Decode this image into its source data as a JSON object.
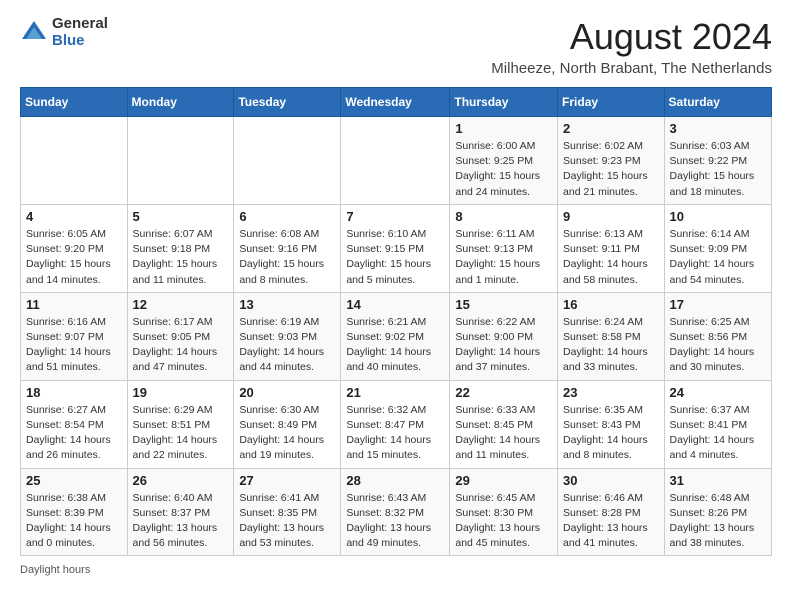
{
  "logo": {
    "general": "General",
    "blue": "Blue"
  },
  "title": "August 2024",
  "subtitle": "Milheeze, North Brabant, The Netherlands",
  "weekdays": [
    "Sunday",
    "Monday",
    "Tuesday",
    "Wednesday",
    "Thursday",
    "Friday",
    "Saturday"
  ],
  "weeks": [
    [
      {
        "day": "",
        "info": ""
      },
      {
        "day": "",
        "info": ""
      },
      {
        "day": "",
        "info": ""
      },
      {
        "day": "",
        "info": ""
      },
      {
        "day": "1",
        "info": "Sunrise: 6:00 AM\nSunset: 9:25 PM\nDaylight: 15 hours\nand 24 minutes."
      },
      {
        "day": "2",
        "info": "Sunrise: 6:02 AM\nSunset: 9:23 PM\nDaylight: 15 hours\nand 21 minutes."
      },
      {
        "day": "3",
        "info": "Sunrise: 6:03 AM\nSunset: 9:22 PM\nDaylight: 15 hours\nand 18 minutes."
      }
    ],
    [
      {
        "day": "4",
        "info": "Sunrise: 6:05 AM\nSunset: 9:20 PM\nDaylight: 15 hours\nand 14 minutes."
      },
      {
        "day": "5",
        "info": "Sunrise: 6:07 AM\nSunset: 9:18 PM\nDaylight: 15 hours\nand 11 minutes."
      },
      {
        "day": "6",
        "info": "Sunrise: 6:08 AM\nSunset: 9:16 PM\nDaylight: 15 hours\nand 8 minutes."
      },
      {
        "day": "7",
        "info": "Sunrise: 6:10 AM\nSunset: 9:15 PM\nDaylight: 15 hours\nand 5 minutes."
      },
      {
        "day": "8",
        "info": "Sunrise: 6:11 AM\nSunset: 9:13 PM\nDaylight: 15 hours\nand 1 minute."
      },
      {
        "day": "9",
        "info": "Sunrise: 6:13 AM\nSunset: 9:11 PM\nDaylight: 14 hours\nand 58 minutes."
      },
      {
        "day": "10",
        "info": "Sunrise: 6:14 AM\nSunset: 9:09 PM\nDaylight: 14 hours\nand 54 minutes."
      }
    ],
    [
      {
        "day": "11",
        "info": "Sunrise: 6:16 AM\nSunset: 9:07 PM\nDaylight: 14 hours\nand 51 minutes."
      },
      {
        "day": "12",
        "info": "Sunrise: 6:17 AM\nSunset: 9:05 PM\nDaylight: 14 hours\nand 47 minutes."
      },
      {
        "day": "13",
        "info": "Sunrise: 6:19 AM\nSunset: 9:03 PM\nDaylight: 14 hours\nand 44 minutes."
      },
      {
        "day": "14",
        "info": "Sunrise: 6:21 AM\nSunset: 9:02 PM\nDaylight: 14 hours\nand 40 minutes."
      },
      {
        "day": "15",
        "info": "Sunrise: 6:22 AM\nSunset: 9:00 PM\nDaylight: 14 hours\nand 37 minutes."
      },
      {
        "day": "16",
        "info": "Sunrise: 6:24 AM\nSunset: 8:58 PM\nDaylight: 14 hours\nand 33 minutes."
      },
      {
        "day": "17",
        "info": "Sunrise: 6:25 AM\nSunset: 8:56 PM\nDaylight: 14 hours\nand 30 minutes."
      }
    ],
    [
      {
        "day": "18",
        "info": "Sunrise: 6:27 AM\nSunset: 8:54 PM\nDaylight: 14 hours\nand 26 minutes."
      },
      {
        "day": "19",
        "info": "Sunrise: 6:29 AM\nSunset: 8:51 PM\nDaylight: 14 hours\nand 22 minutes."
      },
      {
        "day": "20",
        "info": "Sunrise: 6:30 AM\nSunset: 8:49 PM\nDaylight: 14 hours\nand 19 minutes."
      },
      {
        "day": "21",
        "info": "Sunrise: 6:32 AM\nSunset: 8:47 PM\nDaylight: 14 hours\nand 15 minutes."
      },
      {
        "day": "22",
        "info": "Sunrise: 6:33 AM\nSunset: 8:45 PM\nDaylight: 14 hours\nand 11 minutes."
      },
      {
        "day": "23",
        "info": "Sunrise: 6:35 AM\nSunset: 8:43 PM\nDaylight: 14 hours\nand 8 minutes."
      },
      {
        "day": "24",
        "info": "Sunrise: 6:37 AM\nSunset: 8:41 PM\nDaylight: 14 hours\nand 4 minutes."
      }
    ],
    [
      {
        "day": "25",
        "info": "Sunrise: 6:38 AM\nSunset: 8:39 PM\nDaylight: 14 hours\nand 0 minutes."
      },
      {
        "day": "26",
        "info": "Sunrise: 6:40 AM\nSunset: 8:37 PM\nDaylight: 13 hours\nand 56 minutes."
      },
      {
        "day": "27",
        "info": "Sunrise: 6:41 AM\nSunset: 8:35 PM\nDaylight: 13 hours\nand 53 minutes."
      },
      {
        "day": "28",
        "info": "Sunrise: 6:43 AM\nSunset: 8:32 PM\nDaylight: 13 hours\nand 49 minutes."
      },
      {
        "day": "29",
        "info": "Sunrise: 6:45 AM\nSunset: 8:30 PM\nDaylight: 13 hours\nand 45 minutes."
      },
      {
        "day": "30",
        "info": "Sunrise: 6:46 AM\nSunset: 8:28 PM\nDaylight: 13 hours\nand 41 minutes."
      },
      {
        "day": "31",
        "info": "Sunrise: 6:48 AM\nSunset: 8:26 PM\nDaylight: 13 hours\nand 38 minutes."
      }
    ]
  ],
  "footer": "Daylight hours"
}
